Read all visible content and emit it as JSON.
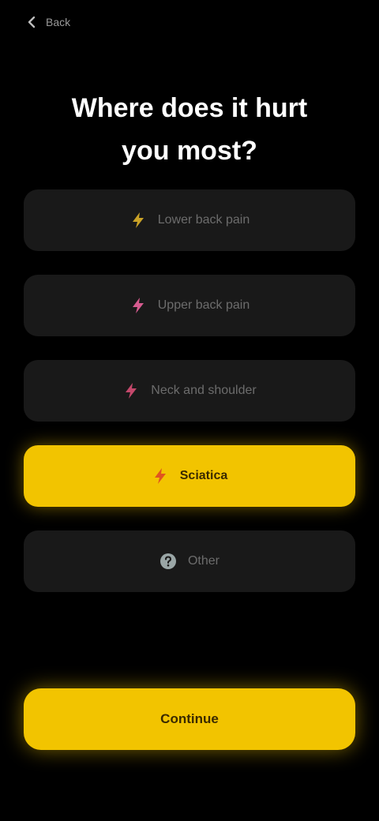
{
  "header": {
    "back_label": "Back",
    "back_icon": "chevron-left-icon"
  },
  "title": {
    "line1": "Where does it hurt",
    "line2": "you most?"
  },
  "options": [
    {
      "label": "Lower back pain",
      "icon": "lightning-icon",
      "icon_color": "#c9a227",
      "selected": false
    },
    {
      "label": "Upper back pain",
      "icon": "lightning-icon",
      "icon_color": "#d65b8f",
      "selected": false
    },
    {
      "label": "Neck and shoulder",
      "icon": "lightning-icon",
      "icon_color": "#c4486b",
      "selected": false
    },
    {
      "label": "Sciatica",
      "icon": "lightning-icon",
      "icon_color": "#e0541f",
      "selected": true
    },
    {
      "label": "Other",
      "icon": "question-icon",
      "icon_color": "#9aa6a6",
      "selected": false
    }
  ],
  "continue": {
    "label": "Continue"
  },
  "colors": {
    "accent": "#f2c400",
    "background": "#000000",
    "card": "#191919"
  }
}
